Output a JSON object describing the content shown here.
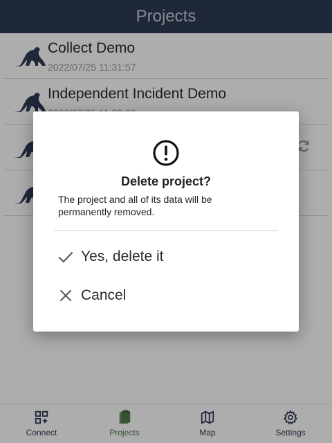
{
  "header": {
    "title": "Projects"
  },
  "projects": [
    {
      "title": "Collect Demo",
      "date": "2022/07/25 11:31:57",
      "sync": false
    },
    {
      "title": "Independent Incident Demo",
      "date": "2022/07/25 11:32:06",
      "sync": false
    },
    {
      "title": "",
      "date": "",
      "sync": true
    },
    {
      "title": "",
      "date": "",
      "sync": false
    }
  ],
  "dialog": {
    "icon": "alert-circle-icon",
    "title": "Delete project?",
    "message": "The project and all of its data will be permanently removed.",
    "confirm_label": "Yes, delete it",
    "cancel_label": "Cancel"
  },
  "nav": {
    "items": [
      {
        "label": "Connect",
        "icon": "qr-add-icon"
      },
      {
        "label": "Projects",
        "icon": "clipboard-icon",
        "active": true
      },
      {
        "label": "Map",
        "icon": "map-icon"
      },
      {
        "label": "Settings",
        "icon": "gear-icon"
      }
    ]
  },
  "colors": {
    "header_bg": "#2f3b55",
    "active_nav": "#4f7a4a"
  }
}
